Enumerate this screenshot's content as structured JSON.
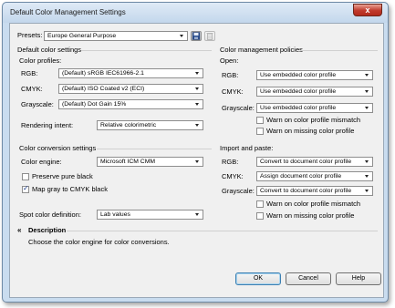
{
  "window": {
    "title": "Default Color Management Settings",
    "close_glyph": "x"
  },
  "presets": {
    "label": "Presets:",
    "value": "Europe General Purpose",
    "save_icon": "save-icon",
    "delete_icon": "delete-icon"
  },
  "left": {
    "section_title": "Default color settings",
    "color_profiles_label": "Color profiles:",
    "rgb_label": "RGB:",
    "rgb_value": "(Default) sRGB IEC61966-2.1",
    "cmyk_label": "CMYK:",
    "cmyk_value": "(Default) ISO Coated v2 (ECI)",
    "grayscale_label": "Grayscale:",
    "grayscale_value": "(Default) Dot Gain 15%",
    "intent_label": "Rendering intent:",
    "intent_value": "Relative colorimetric",
    "conversion_title": "Color conversion settings",
    "engine_label": "Color engine:",
    "engine_value": "Microsoft ICM CMM",
    "preserve_black_label": "Preserve pure black",
    "preserve_black_checked": false,
    "map_gray_label": "Map gray to CMYK black",
    "map_gray_checked": true,
    "spot_label": "Spot color definition:",
    "spot_value": "Lab values"
  },
  "right": {
    "section_title": "Color management policies",
    "open_label": "Open:",
    "open_rgb_label": "RGB:",
    "open_rgb_value": "Use embedded color profile",
    "open_cmyk_label": "CMYK:",
    "open_cmyk_value": "Use embedded color profile",
    "open_gray_label": "Grayscale:",
    "open_gray_value": "Use embedded color profile",
    "open_warn_mismatch": "Warn on color profile mismatch",
    "open_warn_missing": "Warn on missing color profile",
    "import_label": "Import and paste:",
    "imp_rgb_label": "RGB:",
    "imp_rgb_value": "Convert to document color profile",
    "imp_cmyk_label": "CMYK:",
    "imp_cmyk_value": "Assign document color profile",
    "imp_gray_label": "Grayscale:",
    "imp_gray_value": "Convert to document color profile",
    "imp_warn_mismatch": "Warn on color profile mismatch",
    "imp_warn_missing": "Warn on missing color profile"
  },
  "description": {
    "toggle_glyph": "«",
    "title": "Description",
    "text": "Choose the color engine for color conversions."
  },
  "buttons": {
    "ok": "OK",
    "cancel": "Cancel",
    "help": "Help"
  }
}
